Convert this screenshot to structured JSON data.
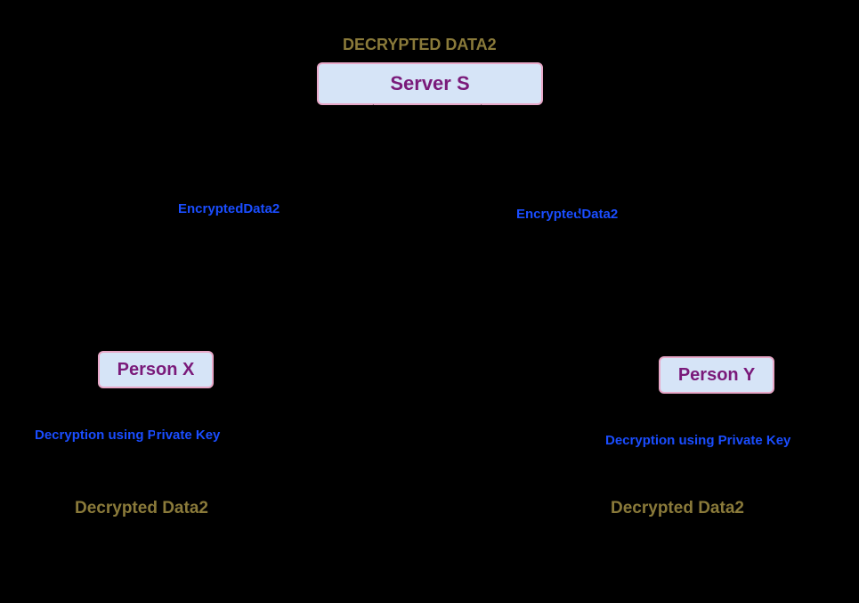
{
  "title": "DECRYPTED DATA2",
  "nodes": {
    "server": "Server S",
    "personX": "Person X",
    "personY": "Person Y"
  },
  "edges": {
    "leftEdge": "EncryptedData2",
    "rightEdge": "EncryptedData2"
  },
  "captions": {
    "xDecrypt": "Decryption using Private Key",
    "yDecrypt": "Decryption using Private Key",
    "xResult": "Decrypted Data2",
    "yResult": "Decrypted Data2"
  },
  "colors": {
    "nodeFill": "#d6e4f7",
    "nodeBorder": "#e8a8c8",
    "nodeText": "#7a1a7a",
    "olive": "#8a7a3a",
    "blue": "#1a4dff",
    "bg": "#000000"
  }
}
